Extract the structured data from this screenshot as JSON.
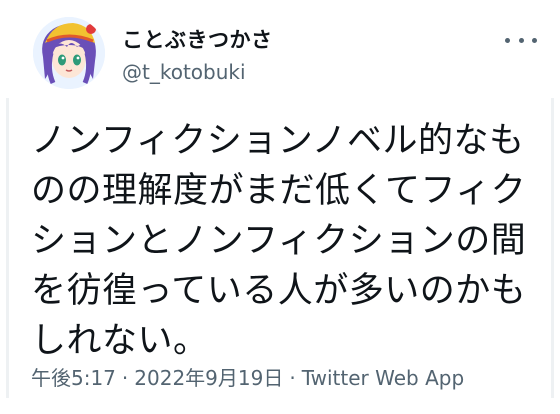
{
  "user": {
    "display_name": "ことぶきつかさ",
    "handle": "@t_kotobuki"
  },
  "icons": {
    "avatar": "avatar-illustration",
    "more": "more-horizontal-icon"
  },
  "tweet": {
    "lines": [
      "ノンフィクションノベル的なも",
      "のの理解度がまだ低くてフィク",
      "ションとノンフィクションの間",
      "を彷徨っている人が多いのかも",
      "しれない。"
    ]
  },
  "meta": {
    "time": "午後5:17",
    "separator": "·",
    "date": "2022年9月19日",
    "source": "Twitter Web App"
  },
  "colors": {
    "text": "#0f1419",
    "secondary": "#536471"
  }
}
